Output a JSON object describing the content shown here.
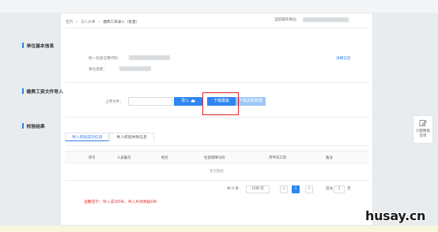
{
  "breadcrumb": {
    "home": "首页",
    "level1": "法人办事",
    "current": "缴费工资录入（批量）",
    "separator": ">"
  },
  "unit": {
    "label": "当前操作单位："
  },
  "section_basic": {
    "title": "单位基本信息",
    "credit_code_label": "统一社会信用代码：",
    "unit_name_label": "单位名称：",
    "detail_link": "详细信息"
  },
  "section_import": {
    "title": "缴费工资文件导入",
    "upload_label": "上传文件：",
    "file_placeholder": "...",
    "import_button": "导入",
    "download_button": "下载模板",
    "download_fail_button": "下载失败数据"
  },
  "section_result": {
    "title": "校验结果",
    "tabs": [
      "导入校验成功信息",
      "导入校验失败信息"
    ],
    "columns": [
      "序号",
      "人员编号",
      "姓名",
      "社会保障号码",
      "月平均工资",
      "备注"
    ],
    "empty_text": "暂无数据"
  },
  "pagination": {
    "total": "共 0 条",
    "page_size": "10条/页",
    "prev": "<",
    "current_page": "1",
    "next": ">",
    "goto_label": "前往",
    "goto_value": "1",
    "page_suffix": "页"
  },
  "warning": "温馨提示：导入成功0条，导入失败数据0条",
  "feedback": {
    "line1": "问题数据",
    "line2": "反馈"
  },
  "watermark": "husay.cn",
  "colors": {
    "primary": "#2e86f0",
    "highlight": "#e0242a",
    "warning": "#e4393c"
  }
}
